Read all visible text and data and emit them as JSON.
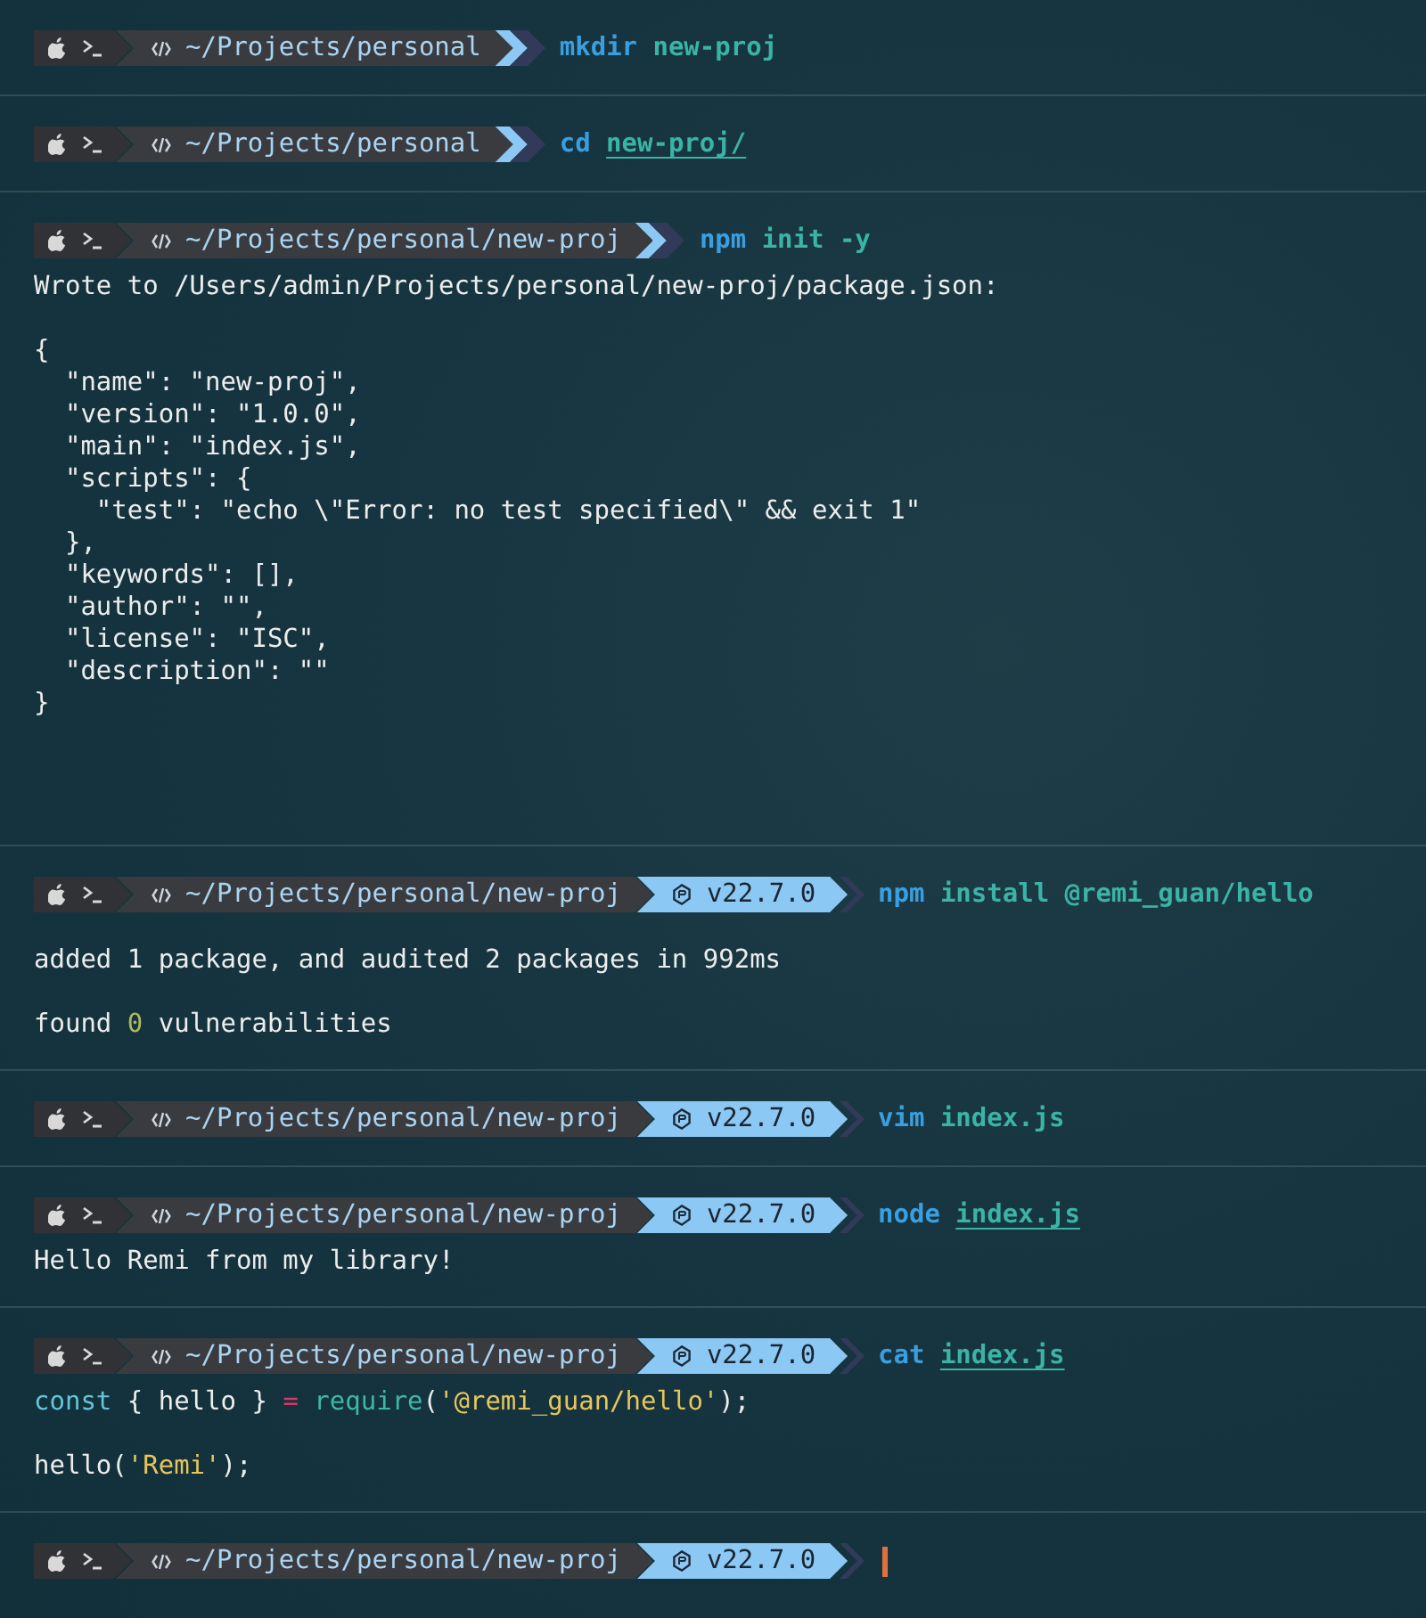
{
  "blocks": [
    {
      "prompt": {
        "path": "~/Projects/personal"
      },
      "command": {
        "name": "mkdir",
        "args": [
          {
            "text": "new-proj",
            "underlined": false
          }
        ]
      }
    },
    {
      "prompt": {
        "path": "~/Projects/personal"
      },
      "command": {
        "name": "cd",
        "args": [
          {
            "text": "new-proj/",
            "underlined": true
          }
        ]
      }
    },
    {
      "prompt": {
        "path": "~/Projects/personal/new-proj"
      },
      "command": {
        "name": "npm",
        "args": [
          {
            "text": "init",
            "underlined": false
          },
          {
            "text": "-y",
            "underlined": false
          }
        ]
      },
      "output": [
        {
          "kind": "text",
          "tokens": [
            {
              "kind": "plain",
              "text": "Wrote to /Users/admin/Projects/personal/new-proj/package.json:"
            }
          ]
        },
        {
          "kind": "blank"
        },
        {
          "kind": "text",
          "tokens": [
            {
              "kind": "plain",
              "text": "{"
            }
          ]
        },
        {
          "kind": "text",
          "tokens": [
            {
              "kind": "plain",
              "text": "  \"name\": \"new-proj\","
            }
          ]
        },
        {
          "kind": "text",
          "tokens": [
            {
              "kind": "plain",
              "text": "  \"version\": \"1.0.0\","
            }
          ]
        },
        {
          "kind": "text",
          "tokens": [
            {
              "kind": "plain",
              "text": "  \"main\": \"index.js\","
            }
          ]
        },
        {
          "kind": "text",
          "tokens": [
            {
              "kind": "plain",
              "text": "  \"scripts\": {"
            }
          ]
        },
        {
          "kind": "text",
          "tokens": [
            {
              "kind": "plain",
              "text": "    \"test\": \"echo \\\"Error: no test specified\\\" && exit 1\""
            }
          ]
        },
        {
          "kind": "text",
          "tokens": [
            {
              "kind": "plain",
              "text": "  },"
            }
          ]
        },
        {
          "kind": "text",
          "tokens": [
            {
              "kind": "plain",
              "text": "  \"keywords\": [],"
            }
          ]
        },
        {
          "kind": "text",
          "tokens": [
            {
              "kind": "plain",
              "text": "  \"author\": \"\","
            }
          ]
        },
        {
          "kind": "text",
          "tokens": [
            {
              "kind": "plain",
              "text": "  \"license\": \"ISC\","
            }
          ]
        },
        {
          "kind": "text",
          "tokens": [
            {
              "kind": "plain",
              "text": "  \"description\": \"\""
            }
          ]
        },
        {
          "kind": "text",
          "tokens": [
            {
              "kind": "plain",
              "text": "}"
            }
          ]
        },
        {
          "kind": "blank"
        },
        {
          "kind": "blank"
        },
        {
          "kind": "blank"
        }
      ]
    },
    {
      "prompt": {
        "path": "~/Projects/personal/new-proj",
        "node_version": "v22.7.0"
      },
      "command": {
        "name": "npm",
        "args": [
          {
            "text": "install",
            "underlined": false
          },
          {
            "text": "@remi_guan/hello",
            "underlined": false
          }
        ]
      },
      "output": [
        {
          "kind": "blank"
        },
        {
          "kind": "text",
          "tokens": [
            {
              "kind": "plain",
              "text": "added 1 package, and audited 2 packages in 992ms"
            }
          ]
        },
        {
          "kind": "blank"
        },
        {
          "kind": "text",
          "tokens": [
            {
              "kind": "plain",
              "text": "found "
            },
            {
              "kind": "number",
              "text": "0"
            },
            {
              "kind": "plain",
              "text": " vulnerabilities"
            }
          ]
        }
      ]
    },
    {
      "prompt": {
        "path": "~/Projects/personal/new-proj",
        "node_version": "v22.7.0"
      },
      "command": {
        "name": "vim",
        "args": [
          {
            "text": "index.js",
            "underlined": false
          }
        ]
      }
    },
    {
      "prompt": {
        "path": "~/Projects/personal/new-proj",
        "node_version": "v22.7.0"
      },
      "command": {
        "name": "node",
        "args": [
          {
            "text": "index.js",
            "underlined": true
          }
        ]
      },
      "output": [
        {
          "kind": "text",
          "tokens": [
            {
              "kind": "plain",
              "text": "Hello Remi from my library!"
            }
          ]
        }
      ]
    },
    {
      "prompt": {
        "path": "~/Projects/personal/new-proj",
        "node_version": "v22.7.0"
      },
      "command": {
        "name": "cat",
        "args": [
          {
            "text": "index.js",
            "underlined": true
          }
        ]
      },
      "output": [
        {
          "kind": "code",
          "tokens": [
            {
              "kind": "keyword",
              "text": "const"
            },
            {
              "kind": "plain",
              "text": " { hello }"
            },
            {
              "kind": "operator",
              "text": " = "
            },
            {
              "kind": "function",
              "text": "require"
            },
            {
              "kind": "plain",
              "text": "("
            },
            {
              "kind": "string",
              "text": "'@remi_guan/hello'"
            },
            {
              "kind": "plain",
              "text": ");"
            }
          ]
        },
        {
          "kind": "blank"
        },
        {
          "kind": "code",
          "tokens": [
            {
              "kind": "plain",
              "text": "hello("
            },
            {
              "kind": "string",
              "text": "'Remi'"
            },
            {
              "kind": "plain",
              "text": ");"
            }
          ]
        }
      ]
    },
    {
      "prompt": {
        "path": "~/Projects/personal/new-proj",
        "node_version": "v22.7.0"
      },
      "cursor": true
    }
  ]
}
